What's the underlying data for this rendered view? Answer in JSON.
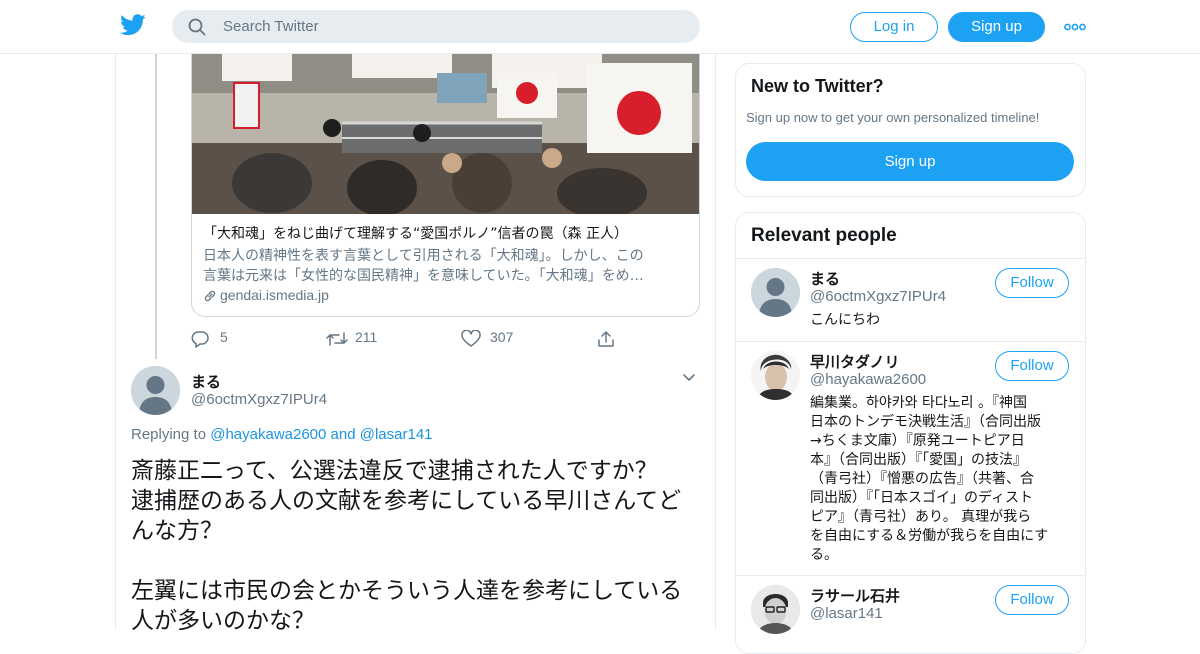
{
  "header": {
    "search_placeholder": "Search Twitter",
    "login_label": "Log in",
    "signup_label": "Sign up",
    "brand_color": "#1da1f2"
  },
  "quoted_card": {
    "title": "「大和魂」をねじ曲げて理解する“愛国ポルノ”信者の罠（森 正人）",
    "description_line1": "日本人の精神性を表す言葉として引用される「大和魂」。しかし、この",
    "description_line2": "言葉は元来は「女性的な国民精神」を意味していた。「大和魂」をめ…",
    "domain": "gendai.ismedia.jp"
  },
  "tweet_actions": {
    "replies": "5",
    "retweets": "211",
    "likes": "307"
  },
  "reply_tweet": {
    "name": "まる",
    "handle": "@6octmXgxz7IPUr4",
    "replying_prefix": "Replying to",
    "replying_user1": "@hayakawa2600",
    "replying_and": "and",
    "replying_user2": "@lasar141",
    "line1": "斎藤正二って、公選法違反で逮捕された人ですか？",
    "line2": "逮捕歴のある人の文献を参考にしている早川さんてど",
    "line3": "んな方？",
    "line4": "左翼には市民の会とかそういう人達を参考にしている",
    "line5": "人が多いのかな？"
  },
  "sidebar": {
    "new_title": "New to Twitter?",
    "new_sub": "Sign up now to get your own personalized timeline!",
    "new_button": "Sign up",
    "relevant_title": "Relevant people",
    "follow_label": "Follow",
    "people": [
      {
        "name": "まる",
        "handle": "@6octmXgxz7IPUr4",
        "bio": "こんにちわ"
      },
      {
        "name": "早川タダノリ",
        "handle": "@hayakawa2600",
        "bio_lines": [
          "編集業。하야카와 타다노리 。『神国",
          "日本のトンデモ決戦生活』（合同出版",
          "→ちくま文庫）『原発ユートピア日",
          "本』（合同出版）『「愛国」の技法』",
          "（青弓社）『憎悪の広告』（共著、合",
          "同出版）『「日本スゴイ」のディスト",
          "ピア』（青弓社）あり。 真理が我ら",
          "を自由にする＆労働が我らを自由にす",
          "る。"
        ]
      },
      {
        "name": "ラサール石井",
        "handle": "@lasar141"
      }
    ]
  }
}
